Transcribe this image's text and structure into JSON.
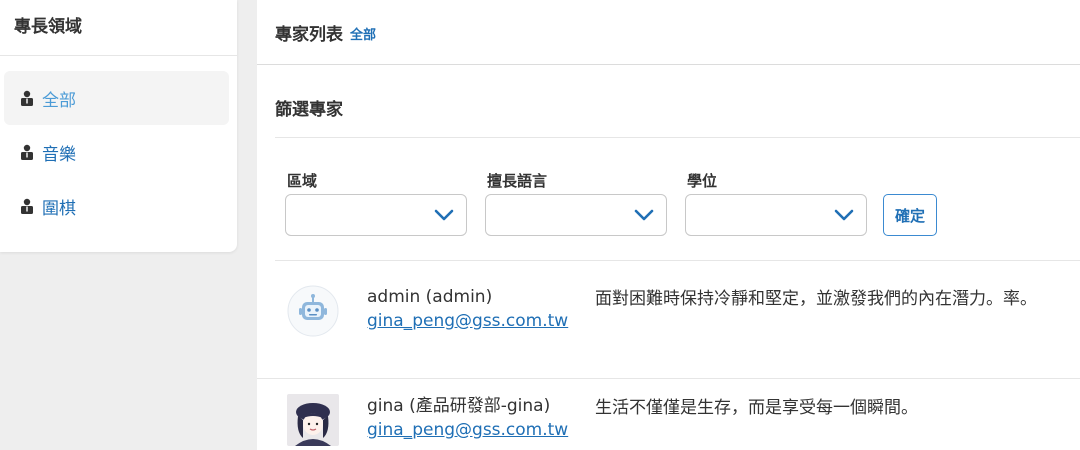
{
  "sidebar": {
    "title": "專長領域",
    "items": [
      {
        "label": "全部",
        "active": true
      },
      {
        "label": "音樂",
        "active": false
      },
      {
        "label": "圍棋",
        "active": false
      }
    ]
  },
  "header": {
    "title": "專家列表",
    "filter_link": "全部"
  },
  "filter": {
    "title": "篩選專家",
    "fields": [
      {
        "label": "區域",
        "value": ""
      },
      {
        "label": "擅長語言",
        "value": ""
      },
      {
        "label": "學位",
        "value": ""
      }
    ],
    "confirm_label": "確定"
  },
  "experts": [
    {
      "name": "admin (admin)",
      "email": "gina_peng@gss.com.tw",
      "quote": "面對困難時保持冷靜和堅定，並激發我們的內在潛力。率。",
      "avatar": "robot-avatar-icon"
    },
    {
      "name": "gina (產品研發部-gina)",
      "email": "gina_peng@gss.com.tw",
      "quote": "生活不僅僅是生存，而是享受每一個瞬間。",
      "avatar": "photo-avatar"
    }
  ],
  "colors": {
    "link": "#1f6fb5",
    "active_link": "#4b9bd6",
    "background": "#eeeeee"
  }
}
